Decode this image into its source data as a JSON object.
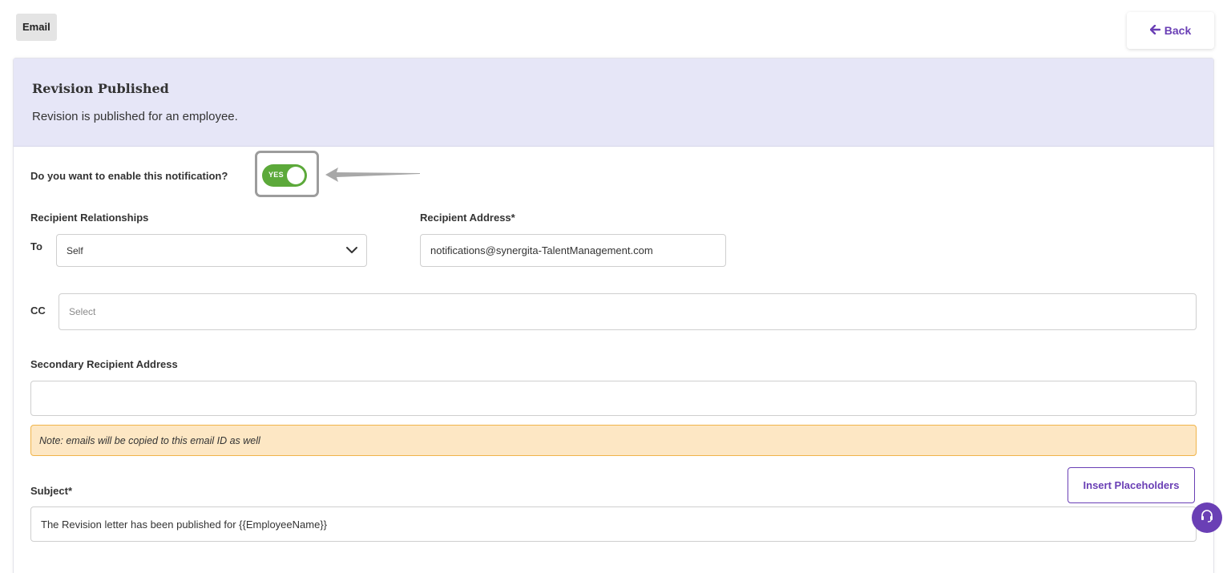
{
  "tab": {
    "label": "Email"
  },
  "back_button": {
    "label": "Back"
  },
  "card": {
    "title": "Revision Published",
    "description": "Revision is published for an employee."
  },
  "enable": {
    "question": "Do you want to enable this notification?",
    "toggle_label": "YES",
    "enabled": true
  },
  "recipient_relationships": {
    "label": "Recipient Relationships",
    "to_label": "To",
    "to_value": "Self"
  },
  "recipient_address": {
    "label": "Recipient Address*",
    "value": "notifications@synergita-TalentManagement.com"
  },
  "cc": {
    "label": "CC",
    "placeholder": "Select"
  },
  "secondary": {
    "label": "Secondary Recipient Address",
    "value": ""
  },
  "note": {
    "text": "Note: emails will be copied to this email ID as well"
  },
  "subject": {
    "label": "Subject*",
    "value": "The Revision letter has been published for {{EmployeeName}}"
  },
  "insert_placeholders": {
    "label": "Insert Placeholders"
  },
  "colors": {
    "accent": "#6a3fb5",
    "toggle_on": "#5ca93a",
    "header_bg": "#e6e6f7",
    "note_bg": "#fde7c4",
    "note_border": "#f0b44a"
  },
  "icons": {
    "back": "arrow-left-icon",
    "dropdown": "chevron-down-icon",
    "help": "headset-icon",
    "pointer": "pointer-arrow-icon"
  }
}
